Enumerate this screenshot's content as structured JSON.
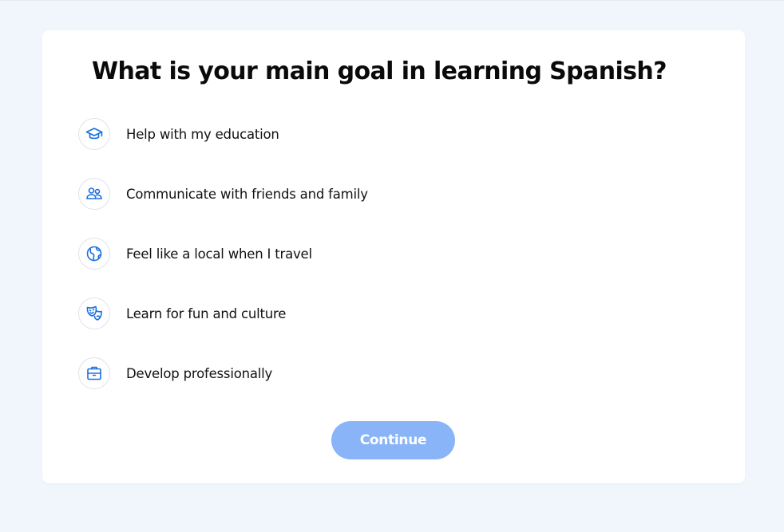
{
  "page": {
    "title": "What is your main goal in learning Spanish?"
  },
  "options": [
    {
      "label": "Help with my education",
      "icon": "graduation-cap-icon"
    },
    {
      "label": "Communicate with friends and family",
      "icon": "people-icon"
    },
    {
      "label": "Feel like a local when I travel",
      "icon": "globe-icon"
    },
    {
      "label": "Learn for fun and culture",
      "icon": "theater-masks-icon"
    },
    {
      "label": "Develop professionally",
      "icon": "briefcase-icon"
    }
  ],
  "actions": {
    "continue_label": "Continue"
  },
  "colors": {
    "background": "#f1f5fc",
    "card": "#ffffff",
    "icon_accent": "#1a6fe0",
    "button_disabled": "#8ab4f8",
    "text": "#111111"
  }
}
